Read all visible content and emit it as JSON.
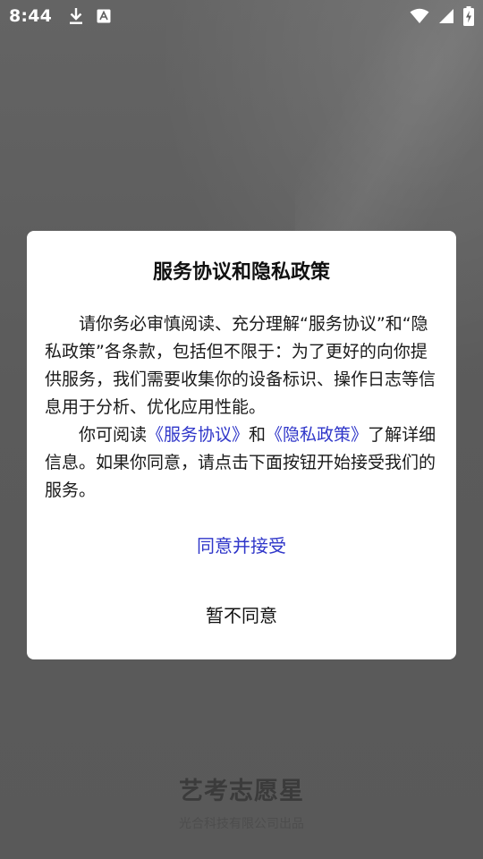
{
  "status_bar": {
    "time": "8:44",
    "left_icons": [
      "download-icon",
      "font-icon"
    ],
    "right_icons": [
      "wifi-icon",
      "signal-icon",
      "battery-charging-icon"
    ]
  },
  "dialog": {
    "title": "服务协议和隐私政策",
    "para1": "请你务必审慎阅读、充分理解“服务协议”和“隐私政策”各条款，包括但不限于：为了更好的向你提供服务，我们需要收集你的设备标识、操作日志等信息用于分析、优化应用性能。",
    "para2_prefix": "你可阅读",
    "service_link": "《服务协议》",
    "and_text": "和",
    "privacy_link": "《隐私政策》",
    "para2_suffix": "了解详细信息。如果你同意，请点击下面按钮开始接受我们的服务。",
    "agree_label": "同意并接受",
    "decline_label": "暂不同意"
  },
  "branding": {
    "app_name": "艺考志愿星",
    "publisher": "光合科技有限公司出品"
  },
  "colors": {
    "accent_link": "#2f36c9",
    "overlay": "#5f5f5f",
    "dialog_bg": "#ffffff"
  }
}
